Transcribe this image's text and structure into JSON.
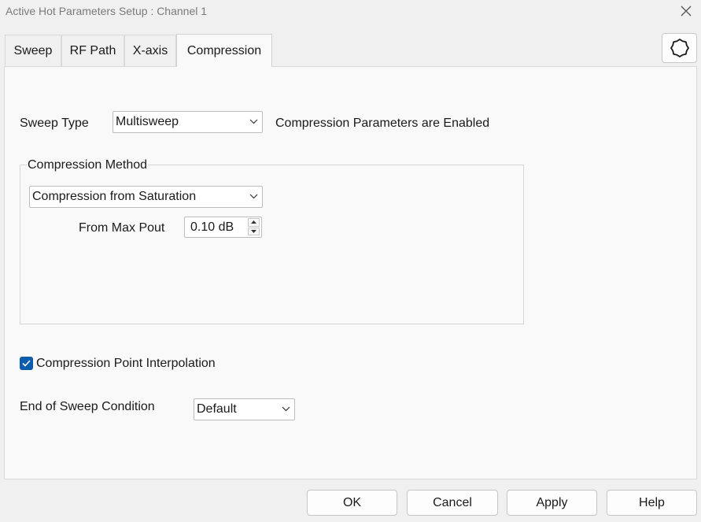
{
  "window": {
    "title": "Active Hot Parameters Setup : Channel 1"
  },
  "tabs": [
    {
      "label": "Sweep"
    },
    {
      "label": "RF Path"
    },
    {
      "label": "X-axis"
    },
    {
      "label": "Compression",
      "active": true
    }
  ],
  "compression": {
    "sweep_type_label": "Sweep Type",
    "sweep_type_value": "Multisweep",
    "status_text": "Compression Parameters are Enabled",
    "method_group_title": "Compression Method",
    "method_value": "Compression from Saturation",
    "from_max_pout_label": "From Max Pout",
    "from_max_pout_value": "0.10 dB",
    "interpolation_label": "Compression Point Interpolation",
    "interpolation_checked": true,
    "end_condition_label": "End of Sweep Condition",
    "end_condition_value": "Default"
  },
  "buttons": {
    "ok": "OK",
    "cancel": "Cancel",
    "apply": "Apply",
    "help": "Help"
  },
  "icons": {
    "close": "close-icon",
    "settings": "gear-icon",
    "dropdown": "chevron-down-icon",
    "check": "check-icon"
  },
  "colors": {
    "accent": "#0b5cad",
    "title_text": "#7a7a7a",
    "panel_bg": "#f9f9f9",
    "window_bg": "#f0f0f0"
  }
}
